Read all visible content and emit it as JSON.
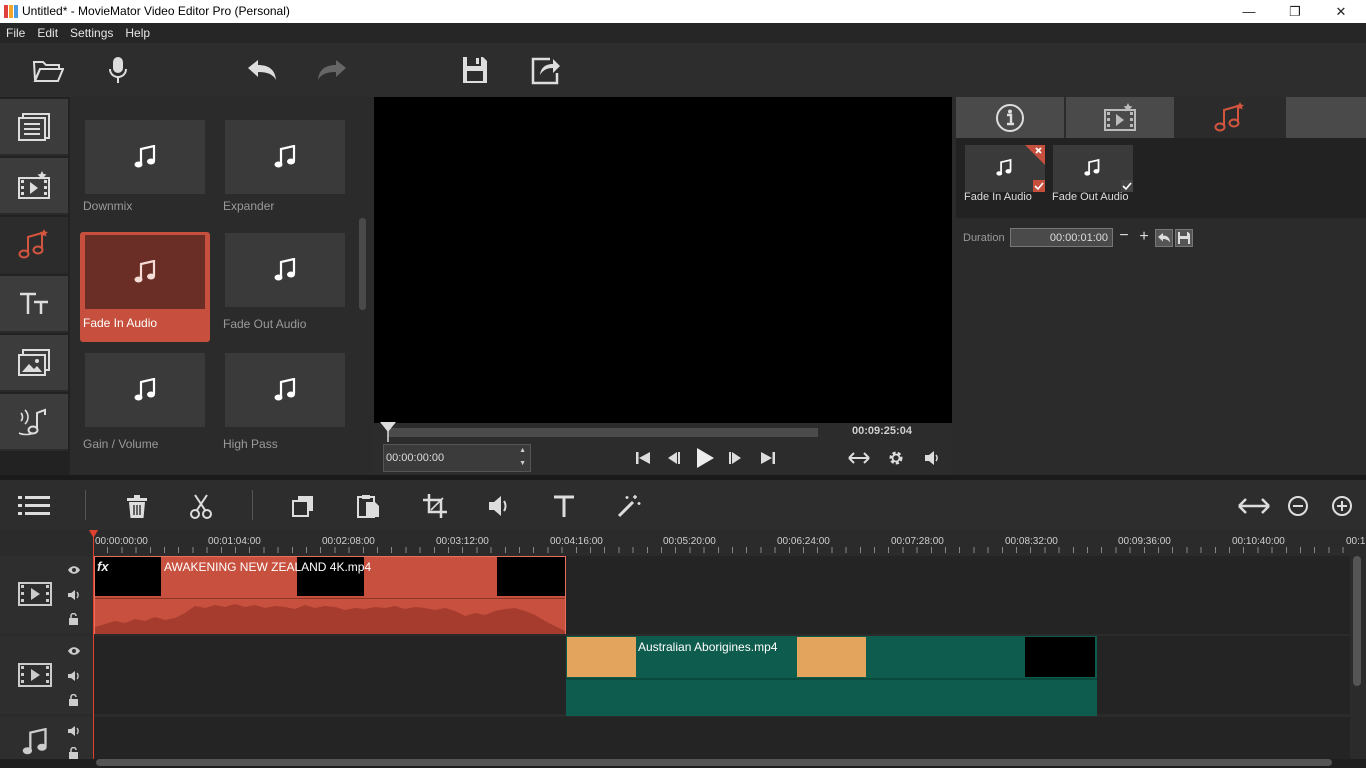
{
  "window": {
    "title": "Untitled* - MovieMator Video Editor Pro (Personal)",
    "minimize": "—",
    "maximize": "❐",
    "close": "✕"
  },
  "menu": [
    "File",
    "Edit",
    "Settings",
    "Help"
  ],
  "toolbar_icons": [
    "open-folder-icon",
    "microphone-icon",
    "undo-icon",
    "redo-icon",
    "save-icon",
    "export-icon"
  ],
  "sidebar_tabs": [
    "media-list-icon",
    "video-filter-icon",
    "audio-filter-icon",
    "text-icon",
    "image-icon",
    "audio-effects-icon"
  ],
  "gallery": {
    "items": [
      {
        "label": "Downmix",
        "selected": false
      },
      {
        "label": "Expander",
        "selected": false
      },
      {
        "label": "Fade In Audio",
        "selected": true
      },
      {
        "label": "Fade Out Audio",
        "selected": false
      },
      {
        "label": "Gain / Volume",
        "selected": false
      },
      {
        "label": "High Pass",
        "selected": false
      }
    ]
  },
  "player": {
    "timecode": "00:00:00:00",
    "duration": "00:09:25:04"
  },
  "properties": {
    "applied_filters": [
      "Fade In Audio",
      "Fade Out Audio"
    ],
    "duration_label": "Duration",
    "duration_value": "00:00:01:00"
  },
  "timeline": {
    "ruler": [
      "00:00:00:00",
      "00:01:04:00",
      "00:02:08:00",
      "00:03:12:00",
      "00:04:16:00",
      "00:05:20:00",
      "00:06:24:00",
      "00:07:28:00",
      "00:08:32:00",
      "00:09:36:00",
      "00:10:40:00",
      "00:1"
    ],
    "clip1": {
      "label": "AWAKENING   NEW ZEALAND 4K.mp4",
      "fx": "fx"
    },
    "clip2": {
      "label": "Australian Aborigines.mp4"
    }
  },
  "colors": {
    "accent": "#c6503d",
    "teal": "#0e5c4d",
    "clip_thumb": "#e3a55e"
  }
}
